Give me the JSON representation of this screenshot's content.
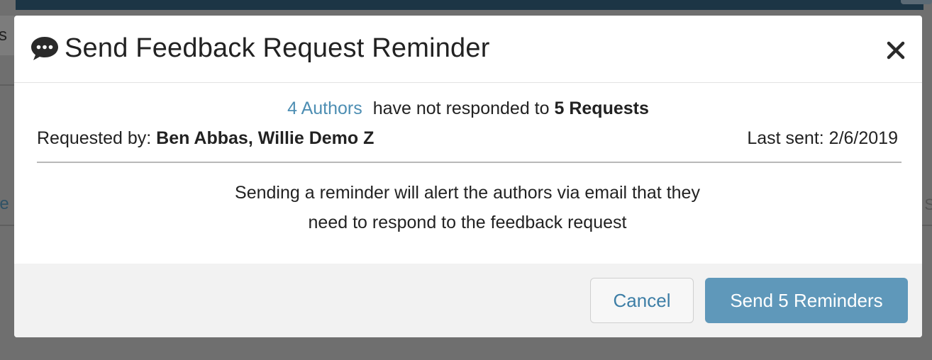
{
  "background": {
    "left_fragment_top": "s",
    "left_fragment_mid": "le",
    "right_fragment_mid": "S"
  },
  "modal": {
    "icon": "chat-bubble-icon",
    "title": "Send Feedback Request Reminder",
    "close_icon": "close-icon"
  },
  "summary": {
    "authors_link": "4 Authors",
    "middle_text": "have not responded to",
    "requests": "5 Requests"
  },
  "requested_by": {
    "label": "Requested by:",
    "names": "Ben Abbas, Willie Demo Z"
  },
  "last_sent": {
    "label": "Last sent:",
    "date": "2/6/2019"
  },
  "message": {
    "line1": "Sending a reminder will alert the authors via email that they",
    "line2": "need to respond to the feedback request"
  },
  "footer": {
    "cancel_label": "Cancel",
    "send_label": "Send 5 Reminders"
  },
  "colors": {
    "link": "#4d8eb3",
    "primary_button": "#5f98ba",
    "overlay": "#6f6f6f",
    "topbar": "#1c3545"
  }
}
